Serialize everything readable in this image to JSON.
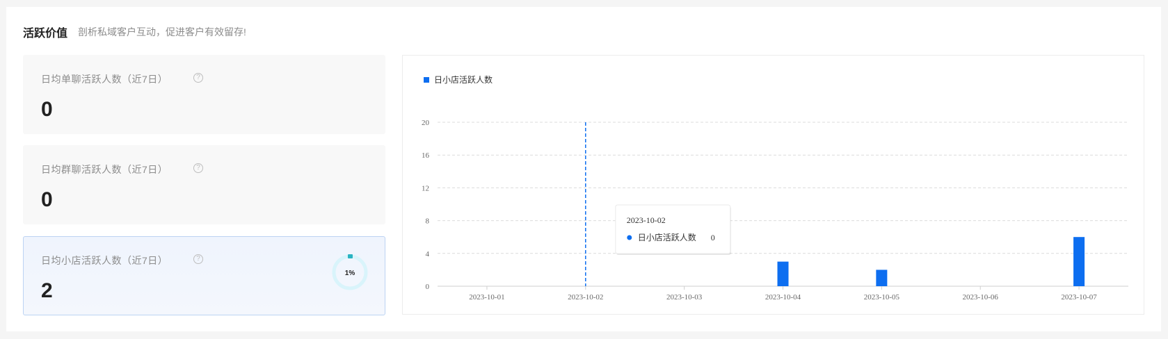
{
  "header": {
    "title": "活跃价值",
    "subtitle": "剖析私域客户互动，促进客户有效留存!"
  },
  "cards": [
    {
      "label": "日均单聊活跃人数（近7日）",
      "value": "0"
    },
    {
      "label": "日均群聊活跃人数（近7日）",
      "value": "0"
    },
    {
      "label": "日均小店活跃人数（近7日）",
      "value": "2",
      "progress_label": "1%",
      "progress": 0.01
    }
  ],
  "help_glyph": "?",
  "colors": {
    "accent": "#0d6ef0",
    "ring": "#d9f4fb",
    "ring_cap": "#2ab3c2",
    "active_border": "#bcd3f3"
  },
  "chart_data": {
    "type": "bar",
    "categories": [
      "2023-10-01",
      "2023-10-02",
      "2023-10-03",
      "2023-10-04",
      "2023-10-05",
      "2023-10-06",
      "2023-10-07"
    ],
    "series": [
      {
        "name": "日小店活跃人数",
        "values": [
          0,
          0,
          0,
          3,
          2,
          0,
          6
        ]
      }
    ],
    "ylim": [
      0,
      20
    ],
    "yticks": [
      0,
      4,
      8,
      12,
      16,
      20
    ],
    "grid": true,
    "legend": "top-left",
    "tooltip": {
      "category": "2023-10-02",
      "series": "日小店活跃人数",
      "value": "0"
    }
  }
}
